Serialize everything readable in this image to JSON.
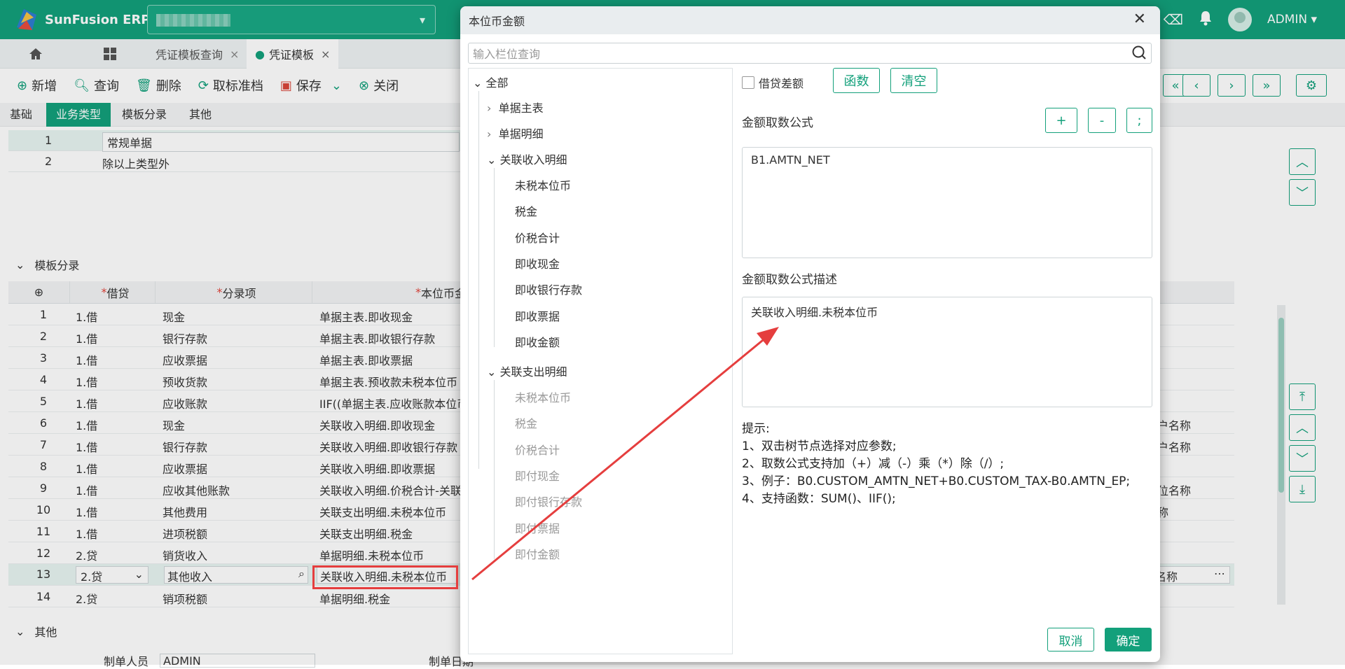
{
  "app": {
    "name": "SunFusion ERP",
    "user": "ADMIN"
  },
  "tabs": [
    "凭证模板查询",
    "凭证模板"
  ],
  "toolbar": {
    "add": "新增",
    "query": "查询",
    "delete": "删除",
    "cancel_approve": "取标准档",
    "save": "保存",
    "close": "关闭"
  },
  "subtabs": [
    "基础",
    "业务类型",
    "模板分录",
    "其他"
  ],
  "biz_types": [
    {
      "no": "1",
      "name": "常规单据"
    },
    {
      "no": "2",
      "name": "除以上类型外"
    }
  ],
  "section_entries": "模板分录",
  "section_other": "其他",
  "grid": {
    "headers": [
      "借贷",
      "分录项",
      "本位币金"
    ],
    "rows": [
      {
        "no": "1",
        "dc": "1.借",
        "item": "现金",
        "amt": "单据主表.即收现金",
        "extra": ""
      },
      {
        "no": "2",
        "dc": "1.借",
        "item": "银行存款",
        "amt": "单据主表.即收银行存款",
        "extra": ""
      },
      {
        "no": "3",
        "dc": "1.借",
        "item": "应收票据",
        "amt": "单据主表.即收票据",
        "extra": ""
      },
      {
        "no": "4",
        "dc": "1.借",
        "item": "预收货款",
        "amt": "单据主表.预收款未税本位币",
        "extra": ""
      },
      {
        "no": "5",
        "dc": "1.借",
        "item": "应收账款",
        "amt": "IIF((单据主表.应收账款本位币",
        "extra": ""
      },
      {
        "no": "6",
        "dc": "1.借",
        "item": "现金",
        "amt": "关联收入明细.即收现金",
        "extra": "户名称"
      },
      {
        "no": "7",
        "dc": "1.借",
        "item": "银行存款",
        "amt": "关联收入明细.即收银行存款",
        "extra": "户名称"
      },
      {
        "no": "8",
        "dc": "1.借",
        "item": "应收票据",
        "amt": "关联收入明细.即收票据",
        "extra": ""
      },
      {
        "no": "9",
        "dc": "1.借",
        "item": "应收其他账款",
        "amt": "关联收入明细.价税合计-关联",
        "extra": "位名称"
      },
      {
        "no": "10",
        "dc": "1.借",
        "item": "其他费用",
        "amt": "关联支出明细.未税本位币",
        "extra": "称"
      },
      {
        "no": "11",
        "dc": "1.借",
        "item": "进项税额",
        "amt": "关联支出明细.税金",
        "extra": ""
      },
      {
        "no": "12",
        "dc": "2.贷",
        "item": "销货收入",
        "amt": "单据明细.未税本位币",
        "extra": ""
      },
      {
        "no": "13",
        "dc": "2.贷",
        "item": "其他收入",
        "amt": "关联收入明细.未税本位币",
        "extra": "名称"
      },
      {
        "no": "14",
        "dc": "2.贷",
        "item": "销项税额",
        "amt": "单据明细.税金",
        "extra": ""
      }
    ]
  },
  "footer": {
    "maker_label": "制单人员",
    "maker": "ADMIN",
    "date_label": "制单日期"
  },
  "dialog": {
    "title": "本位币金额",
    "search_placeholder": "输入栏位查询",
    "tree": {
      "root": "全部",
      "n1": "单据主表",
      "n2": "单据明细",
      "n3": "关联收入明细",
      "n3c": [
        "未税本位币",
        "税金",
        "价税合计",
        "即收现金",
        "即收银行存款",
        "即收票据",
        "即收金额"
      ],
      "n4": "关联支出明细",
      "n4c": [
        "未税本位币",
        "税金",
        "价税合计",
        "即付现金",
        "即付银行存款",
        "即付票据",
        "即付金额"
      ]
    },
    "diff_label": "借贷差额",
    "fn_button": "函数",
    "clear_button": "清空",
    "formula_label": "金额取数公式",
    "op_plus": "+",
    "op_minus": "-",
    "op_semicolon": ";",
    "formula": "B1.AMTN_NET",
    "desc_label": "金额取数公式描述",
    "description": "关联收入明细.未税本位币",
    "hints": [
      "提示:",
      "1、双击树节点选择对应参数;",
      "2、取数公式支持加（+）减（-）乘（*）除（/）;",
      "3、例子：B0.CUSTOM_AMTN_NET+B0.CUSTOM_TAX-B0.AMTN_EP;",
      "4、支持函数：SUM()、IIF();"
    ],
    "cancel": "取消",
    "ok": "确定"
  },
  "colors": {
    "brand": "#13a07b",
    "highlight": "#e53e3e"
  }
}
